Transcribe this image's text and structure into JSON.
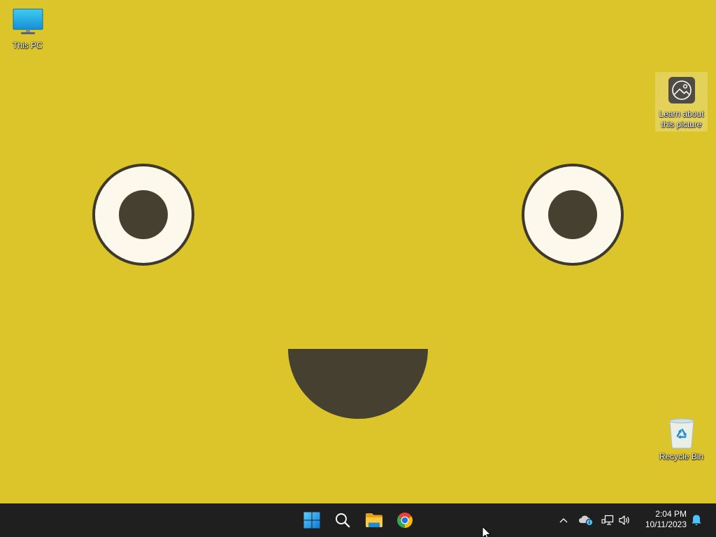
{
  "desktop": {
    "wallpaper": {
      "background": "#dbc52b",
      "eye_white": "#fcf8eb",
      "eye_outline": "#3e392a",
      "pupil": "#464031",
      "mouth": "#464031"
    },
    "icons": [
      {
        "label": "This PC",
        "icon": "this-pc-icon",
        "highlighted": false
      },
      {
        "label": "Learn about this picture",
        "icon": "learn-about-picture-icon",
        "highlighted": true
      },
      {
        "label": "Recycle Bin",
        "icon": "recycle-bin-icon",
        "highlighted": false
      }
    ]
  },
  "taskbar": {
    "background": "#1f1f1f",
    "pinned": [
      {
        "icon": "windows-start-icon"
      },
      {
        "icon": "search-icon"
      },
      {
        "icon": "file-explorer-icon"
      },
      {
        "icon": "chrome-icon"
      }
    ],
    "tray": {
      "icons": [
        "chevron-up-icon",
        "onedrive-cloud-icon",
        "network-icon",
        "volume-icon"
      ],
      "clock": {
        "time": "2:04 PM",
        "date": "10/11/2023"
      },
      "notification_icon": "notification-bell-icon",
      "accent": "#4cc2ff"
    }
  },
  "cursor": {
    "icon": "mouse-pointer-icon"
  }
}
